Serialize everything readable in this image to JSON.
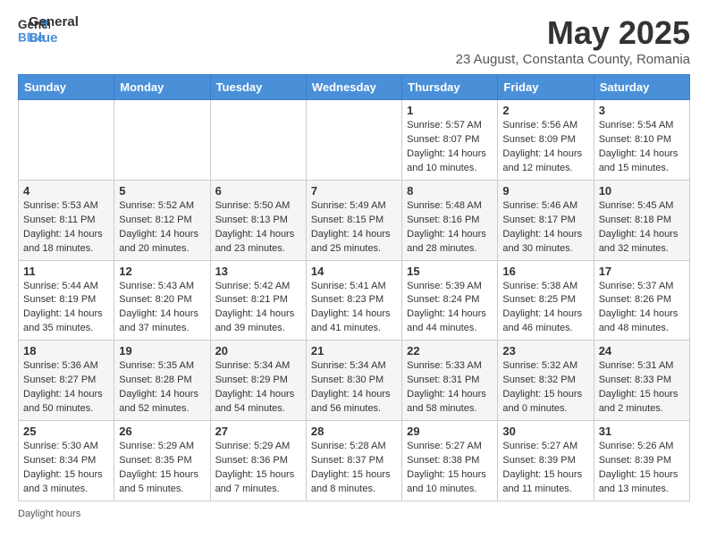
{
  "header": {
    "logo_line1": "General",
    "logo_line2": "Blue",
    "main_title": "May 2025",
    "subtitle": "23 August, Constanta County, Romania"
  },
  "weekdays": [
    "Sunday",
    "Monday",
    "Tuesday",
    "Wednesday",
    "Thursday",
    "Friday",
    "Saturday"
  ],
  "weeks": [
    [
      {
        "day": "",
        "info": ""
      },
      {
        "day": "",
        "info": ""
      },
      {
        "day": "",
        "info": ""
      },
      {
        "day": "",
        "info": ""
      },
      {
        "day": "1",
        "info": "Sunrise: 5:57 AM\nSunset: 8:07 PM\nDaylight: 14 hours\nand 10 minutes."
      },
      {
        "day": "2",
        "info": "Sunrise: 5:56 AM\nSunset: 8:09 PM\nDaylight: 14 hours\nand 12 minutes."
      },
      {
        "day": "3",
        "info": "Sunrise: 5:54 AM\nSunset: 8:10 PM\nDaylight: 14 hours\nand 15 minutes."
      }
    ],
    [
      {
        "day": "4",
        "info": "Sunrise: 5:53 AM\nSunset: 8:11 PM\nDaylight: 14 hours\nand 18 minutes."
      },
      {
        "day": "5",
        "info": "Sunrise: 5:52 AM\nSunset: 8:12 PM\nDaylight: 14 hours\nand 20 minutes."
      },
      {
        "day": "6",
        "info": "Sunrise: 5:50 AM\nSunset: 8:13 PM\nDaylight: 14 hours\nand 23 minutes."
      },
      {
        "day": "7",
        "info": "Sunrise: 5:49 AM\nSunset: 8:15 PM\nDaylight: 14 hours\nand 25 minutes."
      },
      {
        "day": "8",
        "info": "Sunrise: 5:48 AM\nSunset: 8:16 PM\nDaylight: 14 hours\nand 28 minutes."
      },
      {
        "day": "9",
        "info": "Sunrise: 5:46 AM\nSunset: 8:17 PM\nDaylight: 14 hours\nand 30 minutes."
      },
      {
        "day": "10",
        "info": "Sunrise: 5:45 AM\nSunset: 8:18 PM\nDaylight: 14 hours\nand 32 minutes."
      }
    ],
    [
      {
        "day": "11",
        "info": "Sunrise: 5:44 AM\nSunset: 8:19 PM\nDaylight: 14 hours\nand 35 minutes."
      },
      {
        "day": "12",
        "info": "Sunrise: 5:43 AM\nSunset: 8:20 PM\nDaylight: 14 hours\nand 37 minutes."
      },
      {
        "day": "13",
        "info": "Sunrise: 5:42 AM\nSunset: 8:21 PM\nDaylight: 14 hours\nand 39 minutes."
      },
      {
        "day": "14",
        "info": "Sunrise: 5:41 AM\nSunset: 8:23 PM\nDaylight: 14 hours\nand 41 minutes."
      },
      {
        "day": "15",
        "info": "Sunrise: 5:39 AM\nSunset: 8:24 PM\nDaylight: 14 hours\nand 44 minutes."
      },
      {
        "day": "16",
        "info": "Sunrise: 5:38 AM\nSunset: 8:25 PM\nDaylight: 14 hours\nand 46 minutes."
      },
      {
        "day": "17",
        "info": "Sunrise: 5:37 AM\nSunset: 8:26 PM\nDaylight: 14 hours\nand 48 minutes."
      }
    ],
    [
      {
        "day": "18",
        "info": "Sunrise: 5:36 AM\nSunset: 8:27 PM\nDaylight: 14 hours\nand 50 minutes."
      },
      {
        "day": "19",
        "info": "Sunrise: 5:35 AM\nSunset: 8:28 PM\nDaylight: 14 hours\nand 52 minutes."
      },
      {
        "day": "20",
        "info": "Sunrise: 5:34 AM\nSunset: 8:29 PM\nDaylight: 14 hours\nand 54 minutes."
      },
      {
        "day": "21",
        "info": "Sunrise: 5:34 AM\nSunset: 8:30 PM\nDaylight: 14 hours\nand 56 minutes."
      },
      {
        "day": "22",
        "info": "Sunrise: 5:33 AM\nSunset: 8:31 PM\nDaylight: 14 hours\nand 58 minutes."
      },
      {
        "day": "23",
        "info": "Sunrise: 5:32 AM\nSunset: 8:32 PM\nDaylight: 15 hours\nand 0 minutes."
      },
      {
        "day": "24",
        "info": "Sunrise: 5:31 AM\nSunset: 8:33 PM\nDaylight: 15 hours\nand 2 minutes."
      }
    ],
    [
      {
        "day": "25",
        "info": "Sunrise: 5:30 AM\nSunset: 8:34 PM\nDaylight: 15 hours\nand 3 minutes."
      },
      {
        "day": "26",
        "info": "Sunrise: 5:29 AM\nSunset: 8:35 PM\nDaylight: 15 hours\nand 5 minutes."
      },
      {
        "day": "27",
        "info": "Sunrise: 5:29 AM\nSunset: 8:36 PM\nDaylight: 15 hours\nand 7 minutes."
      },
      {
        "day": "28",
        "info": "Sunrise: 5:28 AM\nSunset: 8:37 PM\nDaylight: 15 hours\nand 8 minutes."
      },
      {
        "day": "29",
        "info": "Sunrise: 5:27 AM\nSunset: 8:38 PM\nDaylight: 15 hours\nand 10 minutes."
      },
      {
        "day": "30",
        "info": "Sunrise: 5:27 AM\nSunset: 8:39 PM\nDaylight: 15 hours\nand 11 minutes."
      },
      {
        "day": "31",
        "info": "Sunrise: 5:26 AM\nSunset: 8:39 PM\nDaylight: 15 hours\nand 13 minutes."
      }
    ]
  ],
  "footer": {
    "daylight_label": "Daylight hours"
  }
}
